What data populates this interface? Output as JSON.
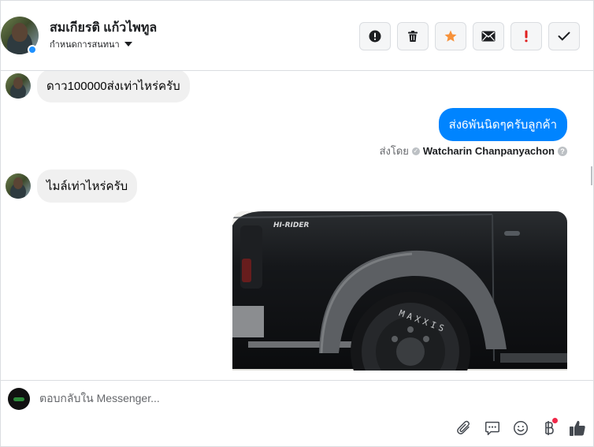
{
  "header": {
    "contact_name": "สมเกียรติ แก้วไพทูล",
    "subtitle": "กำหนดการสนทนา"
  },
  "actions": [
    {
      "name": "report-icon"
    },
    {
      "name": "delete-icon"
    },
    {
      "name": "star-icon",
      "color": "#f7923a"
    },
    {
      "name": "mail-icon"
    },
    {
      "name": "mark-important-icon",
      "color": "#e02020"
    },
    {
      "name": "check-icon"
    }
  ],
  "thread": {
    "messages": [
      {
        "direction": "in",
        "text": "ดาว100000ส่งเท่าไหร่ครับ"
      },
      {
        "direction": "out",
        "text": "ส่ง6พันนิดๆครับลูกค้า"
      },
      {
        "direction": "in",
        "text": "ไมล์เท่าไหร่ครับ"
      }
    ],
    "sent_by_label": "ส่งโดย",
    "sent_by_name": "Watcharin Chanpanyachon",
    "photo_badge": "HI-RIDER",
    "tire_text": "MAXXIS"
  },
  "composer": {
    "placeholder": "ตอบกลับใน Messenger..."
  },
  "colors": {
    "brand_blue": "#0084ff",
    "star": "#f7923a",
    "important": "#e02020"
  }
}
